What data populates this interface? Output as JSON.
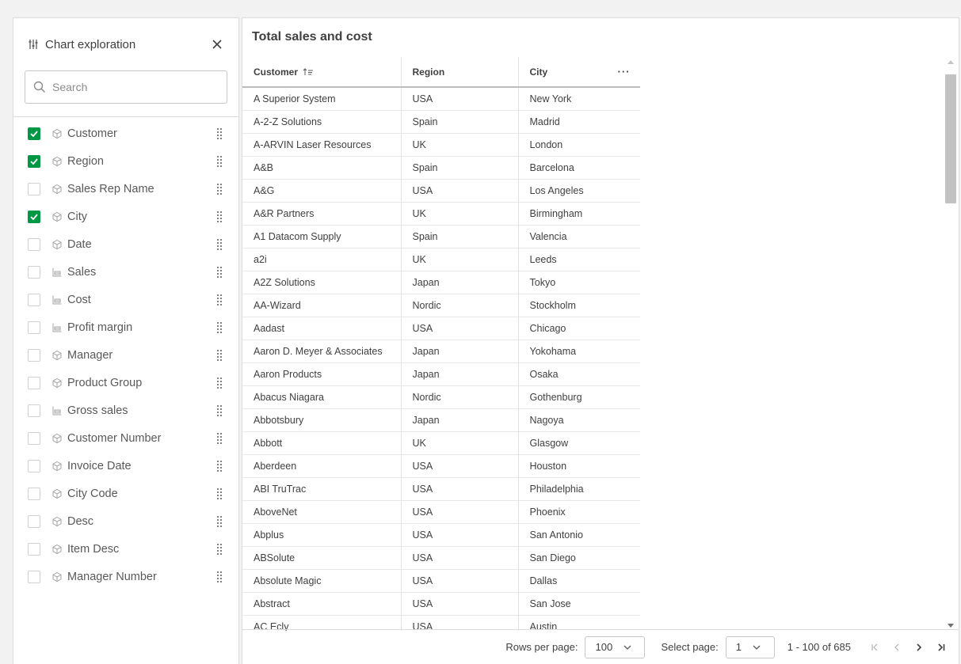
{
  "panel": {
    "title": "Chart exploration",
    "search_placeholder": "Search",
    "fields": [
      {
        "label": "Customer",
        "checked": true,
        "kind": "dimension"
      },
      {
        "label": "Region",
        "checked": true,
        "kind": "dimension"
      },
      {
        "label": "Sales Rep Name",
        "checked": false,
        "kind": "dimension"
      },
      {
        "label": "City",
        "checked": true,
        "kind": "dimension"
      },
      {
        "label": "Date",
        "checked": false,
        "kind": "dimension"
      },
      {
        "label": "Sales",
        "checked": false,
        "kind": "measure"
      },
      {
        "label": "Cost",
        "checked": false,
        "kind": "measure"
      },
      {
        "label": "Profit margin",
        "checked": false,
        "kind": "measure"
      },
      {
        "label": "Manager",
        "checked": false,
        "kind": "dimension"
      },
      {
        "label": "Product Group",
        "checked": false,
        "kind": "dimension"
      },
      {
        "label": "Gross sales",
        "checked": false,
        "kind": "measure"
      },
      {
        "label": "Customer Number",
        "checked": false,
        "kind": "dimension"
      },
      {
        "label": "Invoice Date",
        "checked": false,
        "kind": "dimension"
      },
      {
        "label": "City Code",
        "checked": false,
        "kind": "dimension"
      },
      {
        "label": "Desc",
        "checked": false,
        "kind": "dimension"
      },
      {
        "label": "Item Desc",
        "checked": false,
        "kind": "dimension"
      },
      {
        "label": "Manager Number",
        "checked": false,
        "kind": "dimension"
      }
    ]
  },
  "main": {
    "title": "Total sales and cost",
    "columns": [
      "Customer",
      "Region",
      "City"
    ],
    "column_menu_label": "···",
    "rows": [
      [
        "A Superior System",
        "USA",
        "New York"
      ],
      [
        "A-2-Z Solutions",
        "Spain",
        "Madrid"
      ],
      [
        "A-ARVIN Laser Resources",
        "UK",
        "London"
      ],
      [
        "A&B",
        "Spain",
        "Barcelona"
      ],
      [
        "A&G",
        "USA",
        "Los Angeles"
      ],
      [
        "A&R Partners",
        "UK",
        "Birmingham"
      ],
      [
        "A1 Datacom Supply",
        "Spain",
        "Valencia"
      ],
      [
        "a2i",
        "UK",
        "Leeds"
      ],
      [
        "A2Z Solutions",
        "Japan",
        "Tokyo"
      ],
      [
        "AA-Wizard",
        "Nordic",
        "Stockholm"
      ],
      [
        "Aadast",
        "USA",
        "Chicago"
      ],
      [
        "Aaron D. Meyer & Associates",
        "Japan",
        "Yokohama"
      ],
      [
        "Aaron Products",
        "Japan",
        "Osaka"
      ],
      [
        "Abacus Niagara",
        "Nordic",
        "Gothenburg"
      ],
      [
        "Abbotsbury",
        "Japan",
        "Nagoya"
      ],
      [
        "Abbott",
        "UK",
        "Glasgow"
      ],
      [
        "Aberdeen",
        "USA",
        "Houston"
      ],
      [
        "ABI TruTrac",
        "USA",
        "Philadelphia"
      ],
      [
        "AboveNet",
        "USA",
        "Phoenix"
      ],
      [
        "Abplus",
        "USA",
        "San Antonio"
      ],
      [
        "ABSolute",
        "USA",
        "San Diego"
      ],
      [
        "Absolute Magic",
        "USA",
        "Dallas"
      ],
      [
        "Abstract",
        "USA",
        "San Jose"
      ],
      [
        "AC Ecly",
        "USA",
        "Austin"
      ]
    ],
    "footer": {
      "rows_per_page_label": "Rows per page:",
      "rows_per_page_value": "100",
      "select_page_label": "Select page:",
      "select_page_value": "1",
      "range_text": "1 - 100 of 685"
    }
  },
  "colors": {
    "checkbox_checked": "#009845",
    "border": "#dcdcdc",
    "text": "#404040"
  }
}
